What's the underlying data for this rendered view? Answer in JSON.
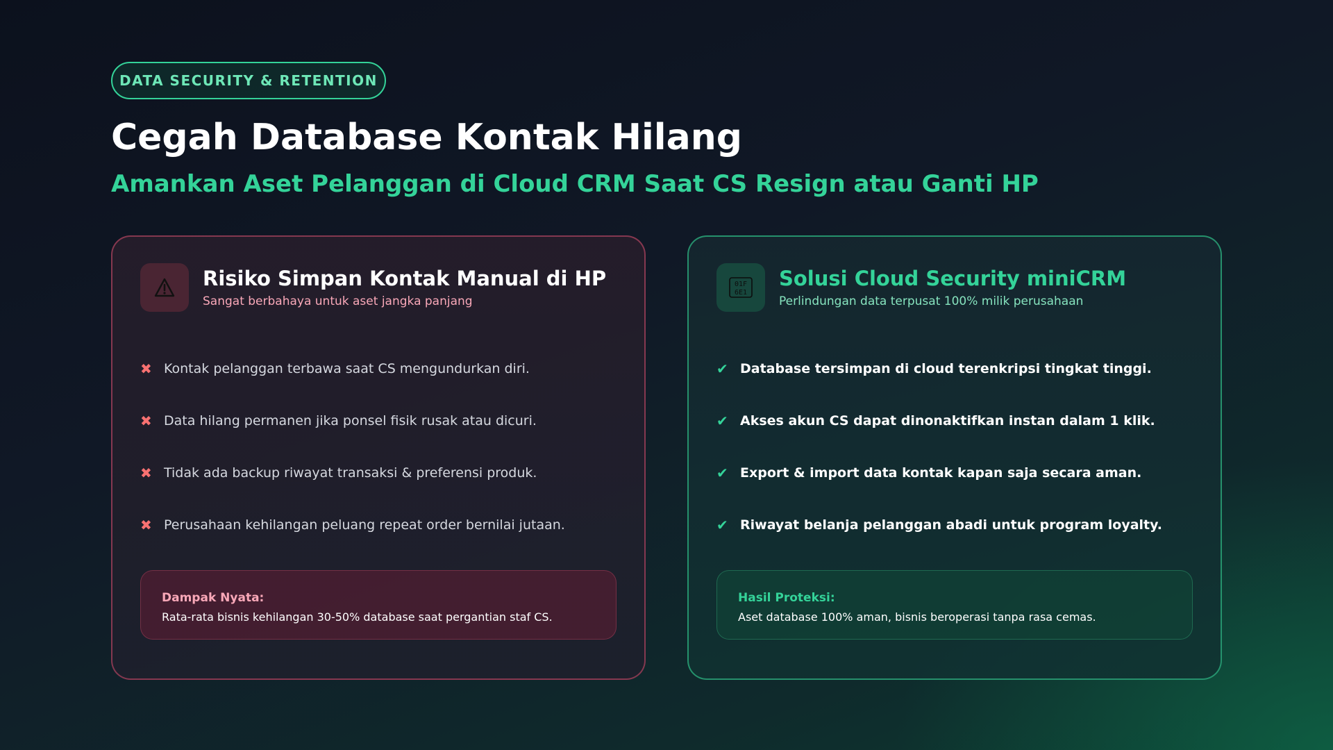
{
  "header": {
    "badge": "DATA SECURITY & RETENTION",
    "title": "Cegah Database Kontak Hilang",
    "subtitle": "Amankan Aset Pelanggan di Cloud CRM Saat CS Resign atau Ganti HP"
  },
  "risk_card": {
    "icon": "warning-icon",
    "title": "Risiko Simpan Kontak Manual di HP",
    "subtitle": "Sangat berbahaya untuk aset jangka panjang",
    "mark": "✖",
    "items": [
      "Kontak pelanggan terbawa saat CS mengundurkan diri.",
      "Data hilang permanen jika ponsel fisik rusak atau dicuri.",
      "Tidak ada backup riwayat transaksi & preferensi produk.",
      "Perusahaan kehilangan peluang repeat order bernilai jutaan."
    ],
    "impact_label": "Dampak Nyata:",
    "impact_text": "Rata-rata bisnis kehilangan 30-50% database saat pergantian staf CS."
  },
  "solution_card": {
    "icon": "binary-code-icon",
    "title": "Solusi Cloud Security miniCRM",
    "subtitle": "Perlindungan data terpusat 100% milik perusahaan",
    "mark": "✔",
    "items": [
      "Database tersimpan di cloud terenkripsi tingkat tinggi.",
      "Akses akun CS dapat dinonaktifkan instan dalam 1 klik.",
      "Export & import data kontak kapan saja secara aman.",
      "Riwayat belanja pelanggan abadi untuk program loyalty."
    ],
    "impact_label": "Hasil Proteksi:",
    "impact_text": "Aset database 100% aman, bisnis beroperasi tanpa rasa cemas."
  },
  "colors": {
    "accent": "#34d399",
    "danger": "#f87171",
    "risk_border": "#be4664"
  }
}
